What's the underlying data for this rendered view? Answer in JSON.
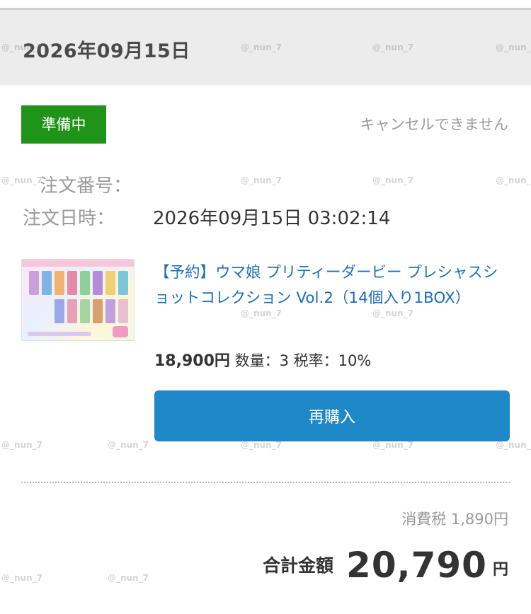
{
  "header": {
    "date": "2026年09月15日"
  },
  "order": {
    "status": "準備中",
    "cancel_note": "キャンセルできません",
    "order_number_label": "注文番号：",
    "order_number_value": "",
    "order_date_label": "注文日時：",
    "order_date_value": "2026年09月15日 03:02:14"
  },
  "item": {
    "title": "【予約】ウマ娘 プリティーダービー プレシャスショットコレクション Vol.2（14個入り1BOX）",
    "price": "18,900円",
    "quantity_text": "数量：3",
    "tax_rate_text": "税率：10%",
    "rebuy_label": "再購入"
  },
  "summary": {
    "tax_label": "消費税",
    "tax_value": "1,890円",
    "total_label": "合計金額",
    "total_amount": "20,790",
    "total_unit": "円"
  },
  "watermark": "@_nun_7",
  "colors": {
    "status_green": "#1f9418",
    "link_blue": "#1e6fb8",
    "button_blue": "#1e88c8",
    "header_gray": "#ececec"
  }
}
